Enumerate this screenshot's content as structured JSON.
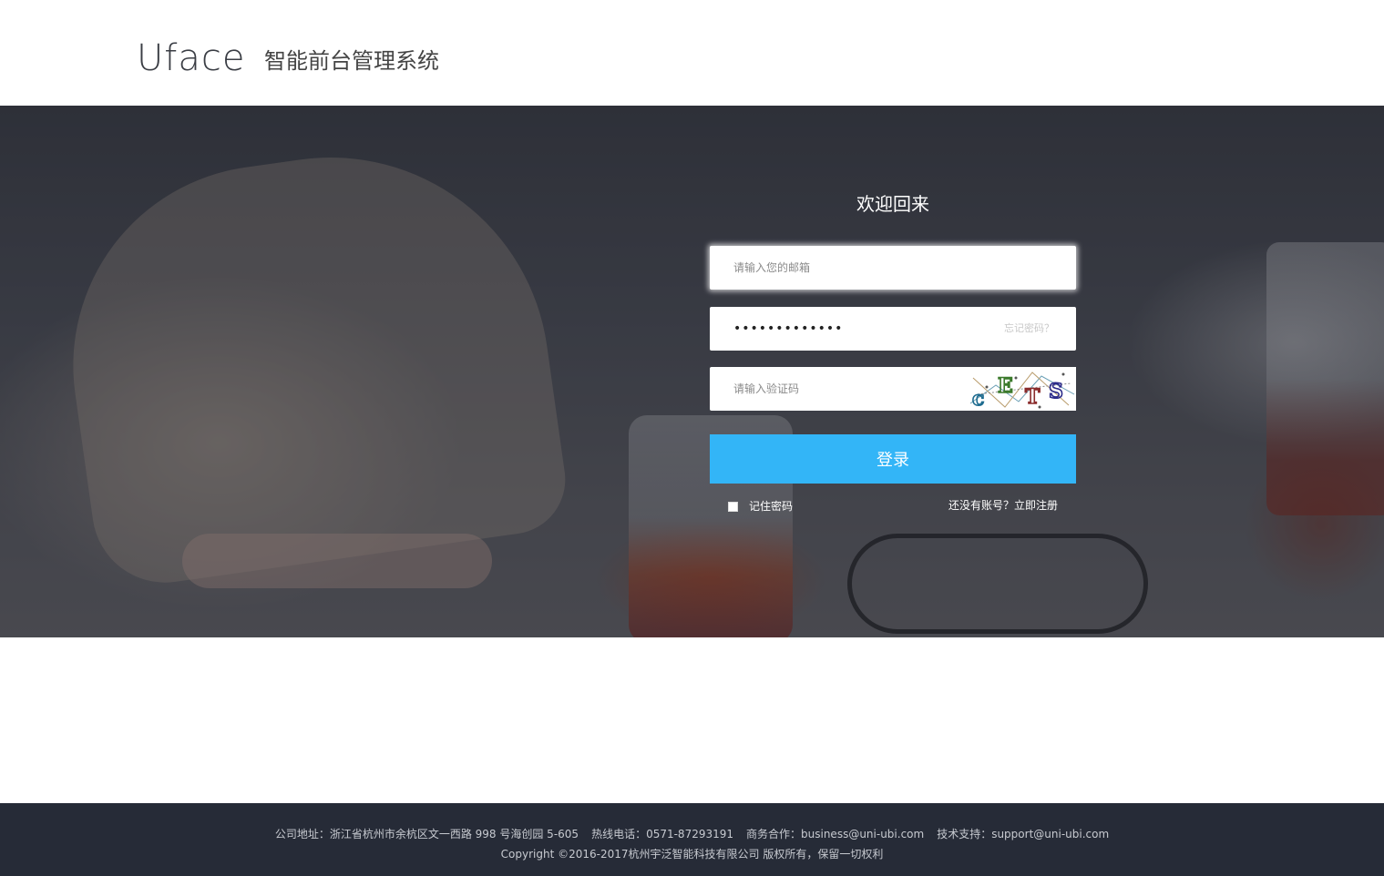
{
  "header": {
    "logo": "Uface",
    "system_name": "智能前台管理系统"
  },
  "login": {
    "welcome": "欢迎回来",
    "email_placeholder": "请输入您的邮箱",
    "password_value": "•••••••••••••",
    "forgot_password": "忘记密码？",
    "code_placeholder": "请输入验证码",
    "captcha_text": "cETS",
    "submit_label": "登录",
    "remember_label": "记住密码",
    "register_label": "还没有账号？立即注册",
    "accent_color": "#33b5f7"
  },
  "footer": {
    "address": "公司地址：浙江省杭州市余杭区文一西路 998 号海创园 5-605",
    "hotline": "热线电话：0571-87293191",
    "business": "商务合作：business@uni-ubi.com",
    "support": "技术支持：support@uni-ubi.com",
    "copyright": "Copyright ©2016-2017杭州宇泛智能科技有限公司 版权所有，保留一切权利"
  }
}
